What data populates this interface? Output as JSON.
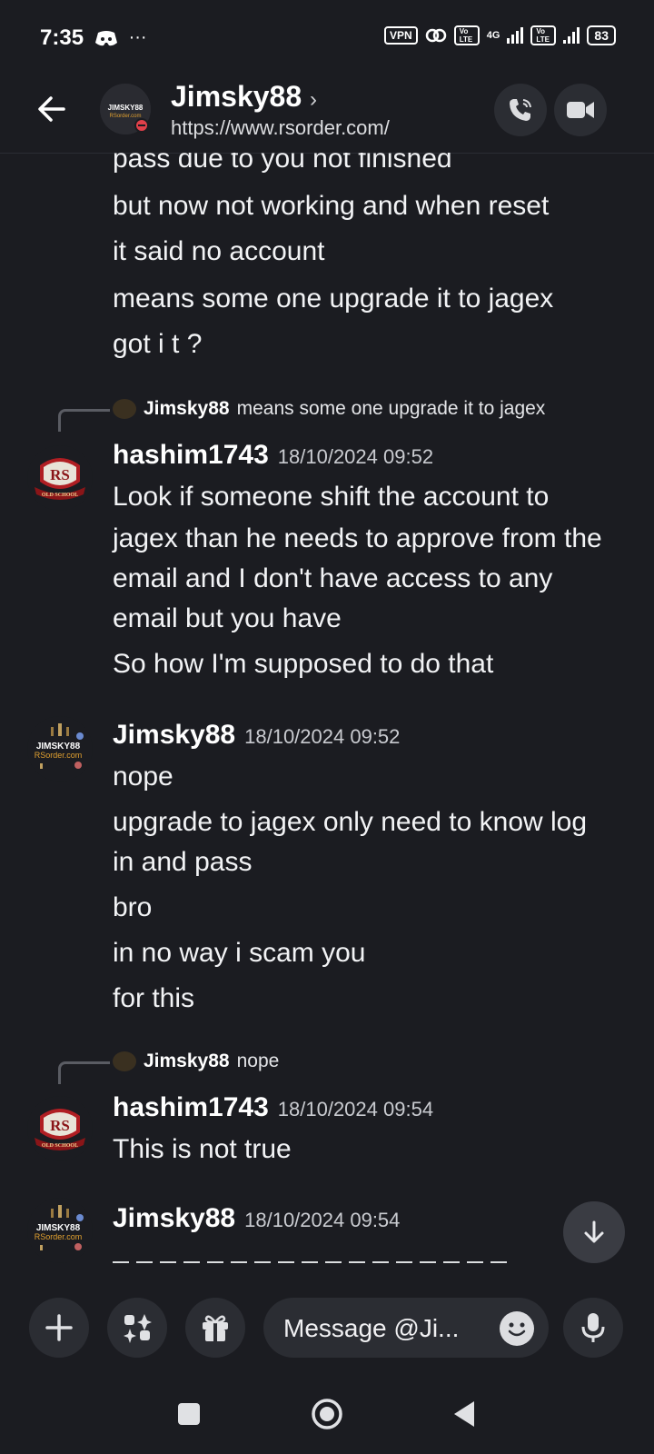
{
  "status_bar": {
    "time": "7:35",
    "left_icons": [
      "discord-status-icon",
      "more-dots-icon"
    ],
    "more": "···",
    "vpn": "VPN",
    "vo_lte_1": "Vo LTE",
    "network": "4G",
    "vo_lte_2": "Vo LTE",
    "battery": "83"
  },
  "header": {
    "title": "Jimsky88",
    "chevron": "›",
    "subtitle": "https://www.rsorder.com/",
    "avatar_text": "JIMSKY88"
  },
  "messages": {
    "continued": [
      "pass due to you not finished",
      "but now not working and when reset",
      "it said no account",
      "means some one upgrade it to jagex",
      "got i t ?"
    ],
    "m1": {
      "reply_author": "Jimsky88",
      "reply_text": "means some one upgrade it to jagex",
      "author": "hashim1743",
      "time": "18/10/2024 09:52",
      "lines": [
        "Look if someone shift the account to",
        "jagex than he needs to approve from the",
        "email and I don't have access to any",
        "email but you have",
        "So how I'm supposed to do that"
      ]
    },
    "m2": {
      "author": "Jimsky88",
      "time": "18/10/2024 09:52",
      "lines": [
        "nope",
        "upgrade to jagex only need to know log",
        "in and pass",
        "bro",
        "in no way i scam you",
        "for this"
      ]
    },
    "m3": {
      "reply_author": "Jimsky88",
      "reply_text": "nope",
      "author": "hashim1743",
      "time": "18/10/2024 09:54",
      "lines": [
        "This is not true"
      ]
    },
    "m4": {
      "author": "Jimsky88",
      "time": "18/10/2024 09:54"
    }
  },
  "avatar_labels": {
    "rs": "RS",
    "old_school": "OLD SCHOOL",
    "jimsky": "JIMSKY88",
    "rsorder": "RSorder.com"
  },
  "composer": {
    "placeholder": "Message @Ji..."
  },
  "colors": {
    "background": "#1b1c21",
    "surface": "#2b2d33",
    "text": "#f2f3f5",
    "muted": "#c9cbd0"
  }
}
